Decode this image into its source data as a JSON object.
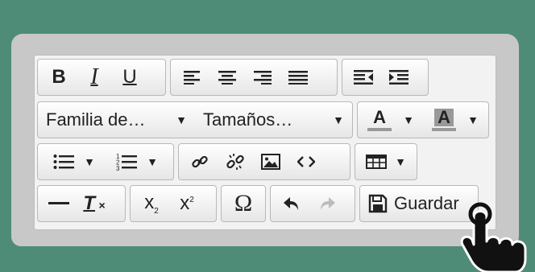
{
  "toolbar": {
    "row1": {
      "bold_label": "B",
      "italic_label": "I",
      "underline_label": "U"
    },
    "row2": {
      "font_family": "Familia de…",
      "font_size": "Tamaños…",
      "text_color_label": "A",
      "bg_color_label": "A"
    },
    "row4": {
      "clear_format_label": "T",
      "subscript_label": "x",
      "superscript_label": "x",
      "special_char_label": "Ω",
      "save_label": "Guardar"
    }
  },
  "colors": {
    "background": "#4e8c78",
    "frame": "#c8c8c8",
    "toolbar": "#f2f2f2"
  }
}
